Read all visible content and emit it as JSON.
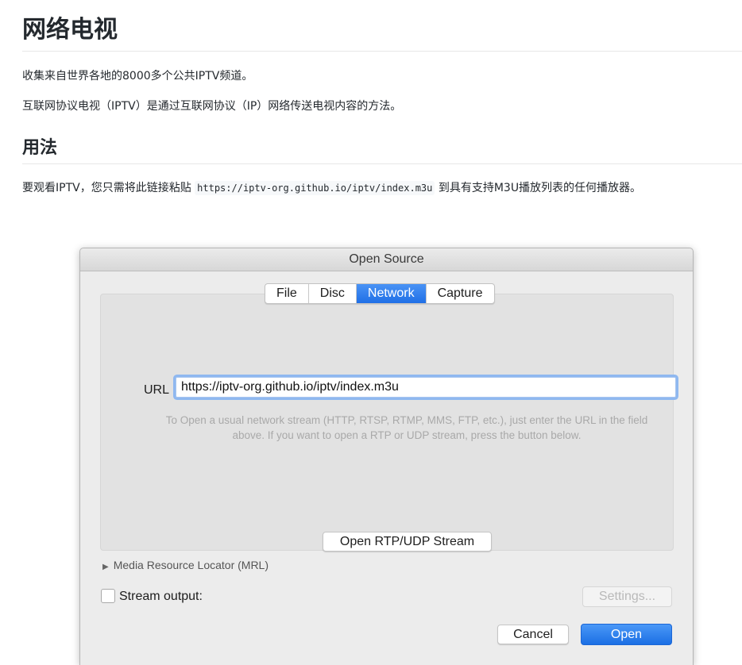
{
  "doc": {
    "title": "网络电视",
    "intro": "收集来自世界各地的8000多个公共IPTV频道。",
    "description": "互联网协议电视（IPTV）是通过互联网协议（IP）网络传送电视内容的方法。",
    "usage_heading": "用法",
    "usage_before": "要观看IPTV，您只需将此链接粘贴",
    "usage_link": "https://iptv-org.github.io/iptv/index.m3u",
    "usage_after": "到具有支持M3U播放列表的任何播放器。"
  },
  "dialog": {
    "title": "Open Source",
    "tabs": [
      {
        "label": "File"
      },
      {
        "label": "Disc"
      },
      {
        "label": "Network",
        "active": true
      },
      {
        "label": "Capture"
      }
    ],
    "url_label": "URL",
    "url_value": "https://iptv-org.github.io/iptv/index.m3u",
    "hint": "To Open a usual network stream (HTTP, RTSP, RTMP, MMS, FTP, etc.), just enter the URL in the field above. If you want to open a RTP or UDP stream, press the button below.",
    "rtp_button": "Open RTP/UDP Stream",
    "mrl_label": "Media Resource Locator (MRL)",
    "stream_output_label": "Stream output:",
    "settings_button": "Settings...",
    "cancel_button": "Cancel",
    "open_button": "Open"
  },
  "colors": {
    "accent": "#1f6fe6",
    "focus_ring": "#8fb8f0"
  }
}
